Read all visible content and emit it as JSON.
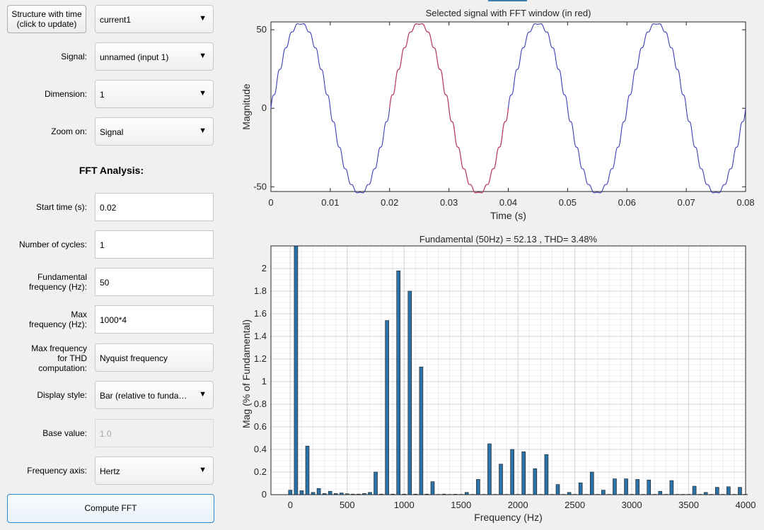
{
  "left": {
    "structure_button": "Structure with time\n(click to update)",
    "structure_value": "current1",
    "signal": {
      "label": "Signal:",
      "value": "unnamed (input 1)"
    },
    "dimension": {
      "label": "Dimension:",
      "value": "1"
    },
    "zoom": {
      "label": "Zoom on:",
      "value": "Signal"
    },
    "fft_title": "FFT Analysis:",
    "start_time": {
      "label": "Start time (s):",
      "value": "0.02"
    },
    "num_cycles": {
      "label": "Number of cycles:",
      "value": "1"
    },
    "fund_freq": {
      "label": "Fundamental\nfrequency (Hz):",
      "value": "50"
    },
    "max_freq": {
      "label": "Max\nfrequency (Hz):",
      "value": "1000*4"
    },
    "max_freq_thd": {
      "label": "Max frequency\nfor THD\ncomputation:",
      "value": "Nyquist frequency"
    },
    "display_style": {
      "label": "Display style:",
      "value": "Bar (relative to funda…"
    },
    "base_value": {
      "label": "Base value:",
      "value": "1.0"
    },
    "freq_axis": {
      "label": "Frequency axis:",
      "value": "Hertz"
    },
    "compute_button": "Compute FFT"
  },
  "chart_data": [
    {
      "type": "line",
      "title": "Selected signal with FFT window (in red)",
      "xlabel": "Time (s)",
      "ylabel": "Magnitude",
      "xlim": [
        0,
        0.08
      ],
      "ylim": [
        -53,
        55
      ],
      "xticks": [
        "0",
        "0.01",
        "0.02",
        "0.03",
        "0.04",
        "0.05",
        "0.06",
        "0.07",
        "0.08"
      ],
      "yticks": [
        "-50",
        "0",
        "50"
      ],
      "series": [
        {
          "color": "#3c3cb4",
          "amplitude": 54,
          "frequency_hz": 50,
          "x_range": [
            0,
            0.08
          ]
        },
        {
          "color": "#c83c5a",
          "amplitude": 54,
          "frequency_hz": 50,
          "x_range": [
            0.02,
            0.04
          ]
        }
      ]
    },
    {
      "type": "bar",
      "title": "Fundamental (50Hz) = 52.13 , THD= 3.48%",
      "xlabel": "Frequency (Hz)",
      "ylabel": "Mag (% of Fundamental)",
      "xlim": [
        -170,
        4000
      ],
      "ylim": [
        0,
        2.2
      ],
      "xticks": [
        "0",
        "500",
        "1000",
        "1500",
        "2000",
        "2500",
        "3000",
        "3500",
        "4000"
      ],
      "yticks": [
        "0",
        "0.2",
        "0.4",
        "0.6",
        "0.8",
        "1",
        "1.2",
        "1.4",
        "1.6",
        "1.8",
        "2"
      ],
      "bar_color": "#2a72a8",
      "x": [
        0,
        50,
        100,
        150,
        200,
        250,
        300,
        350,
        400,
        450,
        500,
        550,
        600,
        650,
        700,
        750,
        800,
        850,
        900,
        950,
        1000,
        1050,
        1100,
        1150,
        1200,
        1250,
        1300,
        1350,
        1400,
        1450,
        1500,
        1550,
        1600,
        1650,
        1700,
        1750,
        1800,
        1850,
        1900,
        1950,
        2000,
        2050,
        2100,
        2150,
        2200,
        2250,
        2300,
        2350,
        2400,
        2450,
        2500,
        2550,
        2600,
        2650,
        2700,
        2750,
        2800,
        2850,
        2900,
        2950,
        3000,
        3050,
        3100,
        3150,
        3200,
        3250,
        3300,
        3350,
        3400,
        3450,
        3500,
        3550,
        3600,
        3650,
        3700,
        3750,
        3800,
        3850,
        3900,
        3950,
        4000
      ],
      "values": [
        0.04,
        2.2,
        0.035,
        0.43,
        0.02,
        0.055,
        0.01,
        0.03,
        0.01,
        0.015,
        0.008,
        0.005,
        0.005,
        0.01,
        0.02,
        0.2,
        0.005,
        1.54,
        0.005,
        1.98,
        0.005,
        1.8,
        0.005,
        1.13,
        0.005,
        0.115,
        0.003,
        0.005,
        0.003,
        0.004,
        0.003,
        0.02,
        0.003,
        0.135,
        0.003,
        0.45,
        0.003,
        0.27,
        0.003,
        0.4,
        0.003,
        0.38,
        0.003,
        0.23,
        0.003,
        0.355,
        0.003,
        0.09,
        0.003,
        0.02,
        0.003,
        0.105,
        0.003,
        0.2,
        0.003,
        0.04,
        0.003,
        0.14,
        0.003,
        0.14,
        0.003,
        0.135,
        0.003,
        0.13,
        0.003,
        0.03,
        0.003,
        0.125,
        0.003,
        0.003,
        0.003,
        0.075,
        0.003,
        0.02,
        0.003,
        0.065,
        0.003,
        0.07,
        0.003,
        0.065,
        0.003
      ]
    }
  ]
}
